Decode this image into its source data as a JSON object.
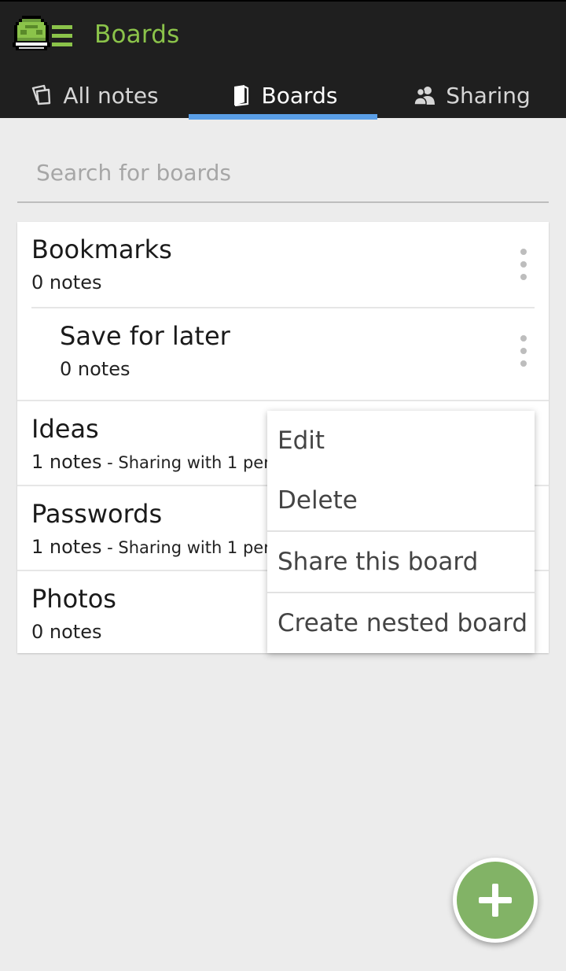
{
  "header": {
    "app_title": "Boards",
    "accent_color": "#8bc34a",
    "logo_icon": "turtle-shell-icon"
  },
  "tabs": [
    {
      "label": "All notes",
      "icon": "notes-icon",
      "active": false
    },
    {
      "label": "Boards",
      "icon": "book-icon",
      "active": true
    },
    {
      "label": "Sharing",
      "icon": "people-icon",
      "active": false
    }
  ],
  "search": {
    "placeholder": "Search for boards",
    "value": ""
  },
  "boards": [
    {
      "name": "Bookmarks",
      "notes": "0 notes",
      "sharing": ""
    },
    {
      "name": "Save for later",
      "notes": "0 notes",
      "sharing": "",
      "nested": true
    },
    {
      "name": "Ideas",
      "notes": "1 notes",
      "sharing": " - Sharing with 1 person"
    },
    {
      "name": "Passwords",
      "notes": "1 notes",
      "sharing": " - Sharing with 1 person"
    },
    {
      "name": "Photos",
      "notes": "0 notes",
      "sharing": ""
    }
  ],
  "context_menu": {
    "items": [
      "Edit",
      "Delete",
      "Share this board",
      "Create nested board"
    ]
  },
  "fab": {
    "icon": "plus-icon",
    "color": "#82b366"
  }
}
